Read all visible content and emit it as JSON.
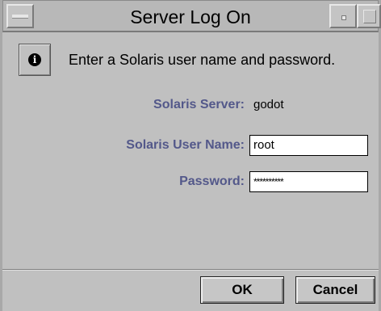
{
  "window": {
    "title": "Server Log On"
  },
  "dialog": {
    "icon": "info-icon",
    "message": "Enter a Solaris user name and password."
  },
  "form": {
    "server_label": "Solaris Server:",
    "server_value": "godot",
    "username_label": "Solaris User Name:",
    "username_value": "root",
    "password_label": "Password:",
    "password_value": "**********"
  },
  "buttons": {
    "ok_label": "OK",
    "cancel_label": "Cancel"
  },
  "colors": {
    "label_text": "#53588a",
    "window_bg": "#c0c0c0"
  }
}
